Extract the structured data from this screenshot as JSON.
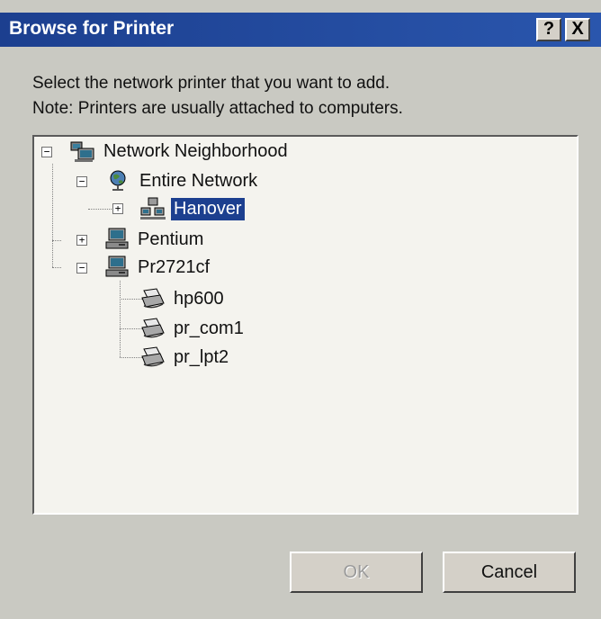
{
  "window": {
    "title": "Browse for Printer",
    "help_label": "?",
    "close_label": "X"
  },
  "instructions": {
    "line1": "Select the network printer that you want to add.",
    "line2": "Note: Printers are usually attached to computers."
  },
  "tree": {
    "network_neighborhood": "Network Neighborhood",
    "entire_network": "Entire Network",
    "hanover": "Hanover",
    "pentium": "Pentium",
    "pr2721cf": "Pr2721cf",
    "hp600": "hp600",
    "pr_com1": "pr_com1",
    "pr_lpt2": "pr_lpt2",
    "selected": "Hanover",
    "expand_symbol": "+",
    "collapse_symbol": "−"
  },
  "buttons": {
    "ok": "OK",
    "ok_enabled": false,
    "cancel": "Cancel"
  },
  "colors": {
    "titlebar": "#1c3f8f",
    "selection": "#1c3f8f",
    "face": "#c9c9c2"
  },
  "icons": {
    "network_neighborhood": "network-neighborhood-icon",
    "entire_network": "globe-icon",
    "hanover": "workgroup-icon",
    "computer": "computer-icon",
    "printer": "printer-icon"
  }
}
